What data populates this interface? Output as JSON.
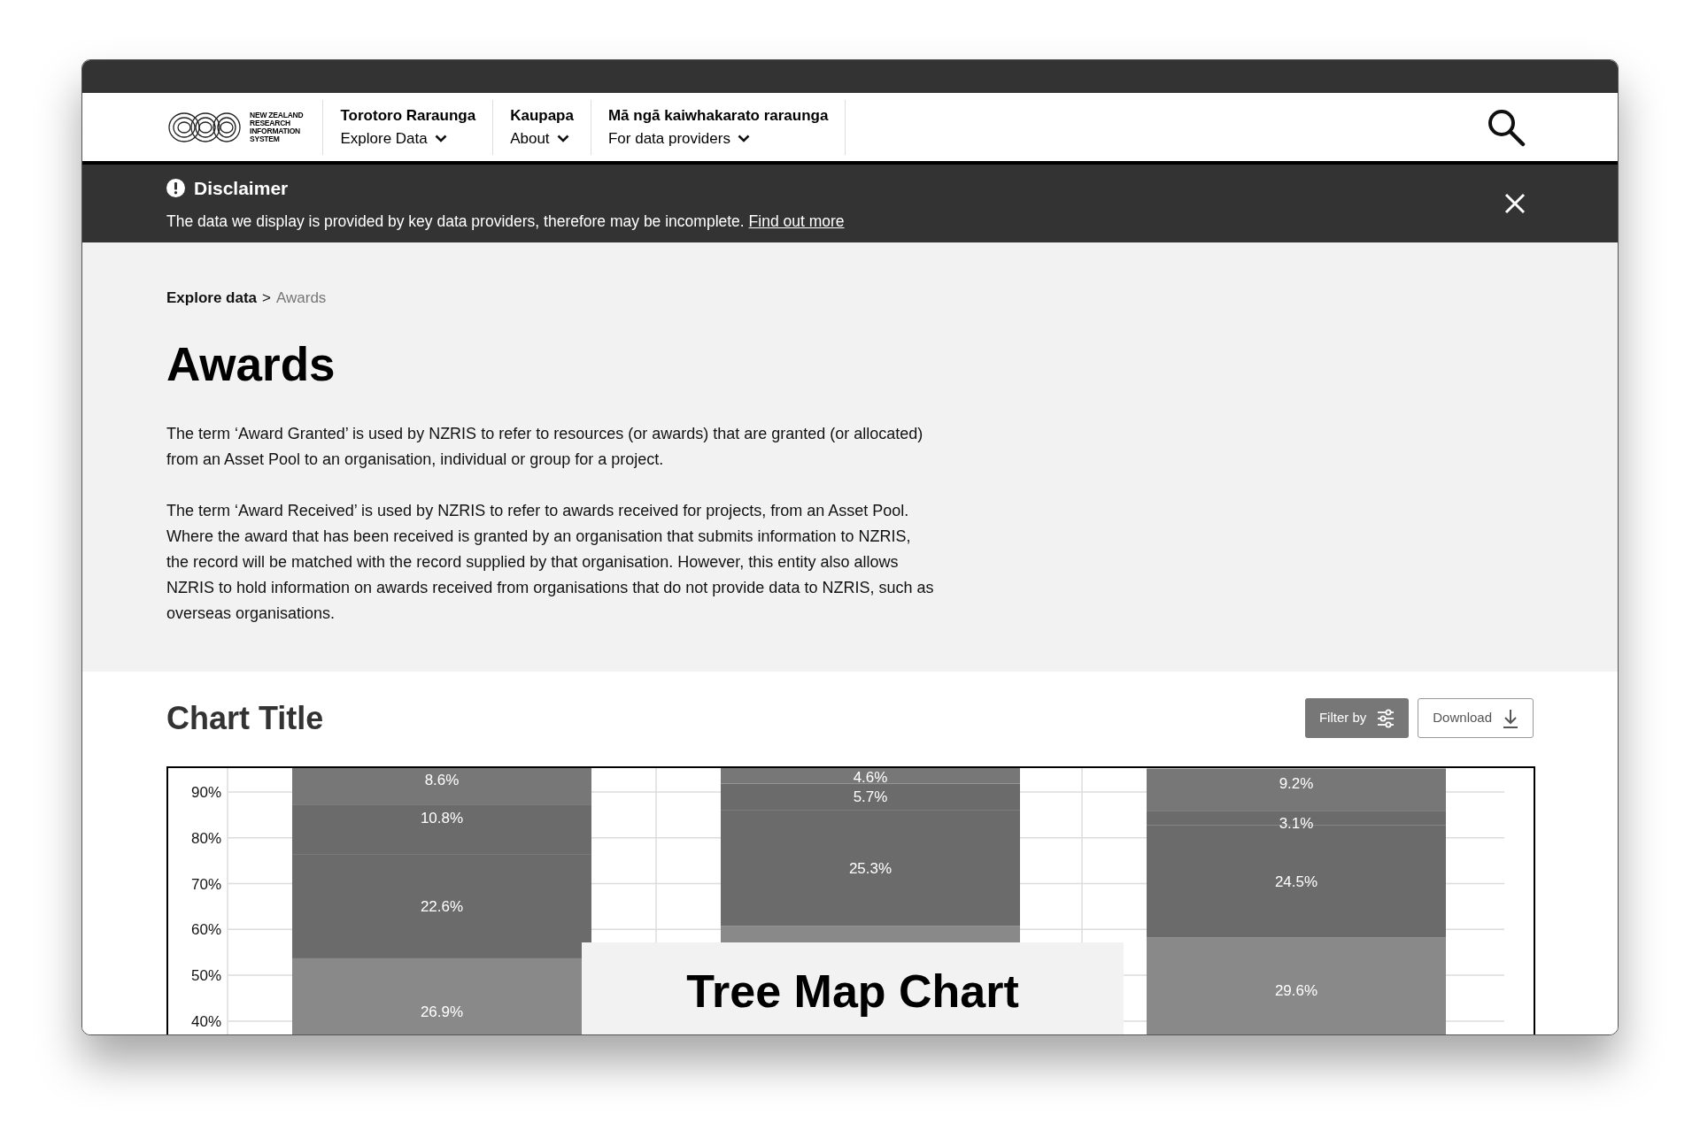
{
  "logo": {
    "lines": [
      "NEW ZEALAND",
      "RESEARCH",
      "INFORMATION",
      "SYSTEM"
    ]
  },
  "nav": [
    {
      "title": "Torotoro Raraunga",
      "label": "Explore Data"
    },
    {
      "title": "Kaupapa",
      "label": "About"
    },
    {
      "title": "Mā ngā kaiwhakarato raraunga",
      "label": "For data providers"
    }
  ],
  "disclaimer": {
    "title": "Disclaimer",
    "text": "The data we display is provided by key data providers, therefore may be incomplete.",
    "link": "Find out more"
  },
  "breadcrumb": {
    "items": [
      {
        "label": "Explore data",
        "current": false
      },
      {
        "label": "Awards",
        "current": true
      }
    ],
    "separator": ">"
  },
  "page_title": "Awards",
  "paragraphs": [
    "The term ‘Award Granted’ is used by NZRIS to refer to resources (or awards) that are granted (or allocated) from an Asset Pool to an organisation, individual or group for a project.",
    "The term ‘Award Received’ is used by NZRIS to refer to awards received for projects, from an Asset Pool. Where the award that has been received is granted by an organisation that submits information to NZRIS, the record will be matched with the record supplied by that organisation. However, this entity also allows NZRIS to hold information on awards received from organisations that do not provide data to NZRIS, such as overseas organisations."
  ],
  "chart_section": {
    "title": "Chart Title",
    "buttons": [
      {
        "label": "Filter by",
        "kind": "filled"
      },
      {
        "label": "Download",
        "kind": "outline"
      }
    ],
    "overlay_label": "Tree Map Chart",
    "chart": {
      "axis_labels": [
        "90%",
        "80%",
        "70%",
        "60%",
        "50%",
        "40%"
      ],
      "bars": [
        {
          "value_labels": [
            "8.6%",
            "10.8%",
            "22.6%",
            "26.9%"
          ]
        },
        {
          "value_labels": [
            "4.6%",
            "5.7%",
            "25.3%"
          ]
        },
        {
          "value_labels": [
            "9.2%",
            "3.1%",
            "24.5%",
            "29.6%"
          ]
        }
      ]
    }
  }
}
